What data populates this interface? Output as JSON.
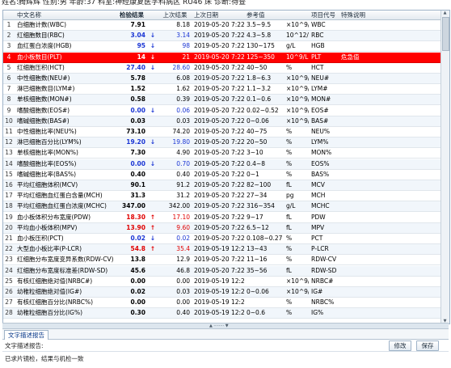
{
  "top_info": "姓名:腾辉辉  性别:男  年龄:37 科室:神经康复医学科病区 RU46 床 诊断:待查",
  "columns": [
    "中文名称",
    "检验结果",
    "上次结果",
    "上次日期",
    "参考值",
    "项目代号",
    "特殊说明"
  ],
  "rows": [
    {
      "idx": "1",
      "name": "白细胞计数(WBC)",
      "result": "7.91",
      "flag": "",
      "last": "8.18",
      "date": "2019-05-20 7:22",
      "ref": "3.5~9.5",
      "unit": "×10^9/L",
      "code": "WBC",
      "note": ""
    },
    {
      "idx": "2",
      "name": "红细胞数目(RBC)",
      "result": "3.04",
      "flag": "↓",
      "last": "3.14",
      "date": "2019-05-20 7:22",
      "ref": "4.3~5.8",
      "unit": "10^12/L",
      "code": "RBC",
      "note": ""
    },
    {
      "idx": "3",
      "name": "血红蛋白浓度(HGB)",
      "result": "95",
      "flag": "↓",
      "last": "98",
      "date": "2019-05-20 7:22",
      "ref": "130~175",
      "unit": "g/L",
      "code": "HGB",
      "note": ""
    },
    {
      "idx": "4",
      "name": "血小板数目(PLT)",
      "result": "14",
      "flag": "↓",
      "last": "21",
      "date": "2019-05-20 7:22",
      "ref": "125~350",
      "unit": "10^9/L",
      "code": "PLT",
      "note": "危急值"
    },
    {
      "idx": "5",
      "name": "红细胞压积(HCT)",
      "result": "27.40",
      "flag": "↓",
      "last": "28.60",
      "date": "2019-05-20 7:22",
      "ref": "40~50",
      "unit": "%",
      "code": "HCT",
      "note": ""
    },
    {
      "idx": "6",
      "name": "中性细胞数(NEU#)",
      "result": "5.78",
      "flag": "",
      "last": "6.08",
      "date": "2019-05-20 7:22",
      "ref": "1.8~6.3",
      "unit": "×10^9/L",
      "code": "NEU#",
      "note": ""
    },
    {
      "idx": "7",
      "name": "淋巴细胞数目(LYM#)",
      "result": "1.52",
      "flag": "",
      "last": "1.62",
      "date": "2019-05-20 7:22",
      "ref": "1.1~3.2",
      "unit": "×10^9/L",
      "code": "LYM#",
      "note": ""
    },
    {
      "idx": "8",
      "name": "单核细胞数(MON#)",
      "result": "0.58",
      "flag": "",
      "last": "0.39",
      "date": "2019-05-20 7:22",
      "ref": "0.1~0.6",
      "unit": "×10^9/L",
      "code": "MON#",
      "note": ""
    },
    {
      "idx": "9",
      "name": "嗜酸细胞数(EOS#)",
      "result": "0.00",
      "flag": "↓",
      "last": "0.06",
      "date": "2019-05-20 7:22",
      "ref": "0.02~0.52",
      "unit": "×10^9/L",
      "code": "EOS#",
      "note": ""
    },
    {
      "idx": "10",
      "name": "嗜碱细胞数(BAS#)",
      "result": "0.03",
      "flag": "",
      "last": "0.03",
      "date": "2019-05-20 7:22",
      "ref": "0~0.06",
      "unit": "×10^9/L",
      "code": "BAS#",
      "note": ""
    },
    {
      "idx": "11",
      "name": "中性细胞比率(NEU%)",
      "result": "73.10",
      "flag": "",
      "last": "74.20",
      "date": "2019-05-20 7:22",
      "ref": "40~75",
      "unit": "%",
      "code": "NEU%",
      "note": ""
    },
    {
      "idx": "12",
      "name": "淋巴细胞百分比(LYM%)",
      "result": "19.20",
      "flag": "↓",
      "last": "19.80",
      "date": "2019-05-20 7:22",
      "ref": "20~50",
      "unit": "%",
      "code": "LYM%",
      "note": ""
    },
    {
      "idx": "13",
      "name": "单核细胞比率(MON%)",
      "result": "7.30",
      "flag": "",
      "last": "4.90",
      "date": "2019-05-20 7:22",
      "ref": "3~10",
      "unit": "%",
      "code": "MON%",
      "note": ""
    },
    {
      "idx": "14",
      "name": "嗜酸细胞比率(EOS%)",
      "result": "0.00",
      "flag": "↓",
      "last": "0.70",
      "date": "2019-05-20 7:22",
      "ref": "0.4~8",
      "unit": "%",
      "code": "EOS%",
      "note": ""
    },
    {
      "idx": "15",
      "name": "嗜碱细胞比率(BAS%)",
      "result": "0.40",
      "flag": "",
      "last": "0.40",
      "date": "2019-05-20 7:22",
      "ref": "0~1",
      "unit": "%",
      "code": "BAS%",
      "note": ""
    },
    {
      "idx": "16",
      "name": "平均红细胞体积(MCV)",
      "result": "90.1",
      "flag": "",
      "last": "91.2",
      "date": "2019-05-20 7:22",
      "ref": "82~100",
      "unit": "fL",
      "code": "MCV",
      "note": ""
    },
    {
      "idx": "17",
      "name": "平均红细胞血红蛋白含量(MCH)",
      "result": "31.3",
      "flag": "",
      "last": "31.2",
      "date": "2019-05-20 7:22",
      "ref": "27~34",
      "unit": "pg",
      "code": "MCH",
      "note": ""
    },
    {
      "idx": "18",
      "name": "平均红细胞血红蛋白浓度(MCHC)",
      "result": "347.00",
      "flag": "",
      "last": "342.00",
      "date": "2019-05-20 7:22",
      "ref": "316~354",
      "unit": "g/L",
      "code": "MCHC",
      "note": ""
    },
    {
      "idx": "19",
      "name": "血小板体积分布宽度(PDW)",
      "result": "18.30",
      "flag": "↑",
      "last": "17.10",
      "date": "2019-05-20 7:22",
      "ref": "9~17",
      "unit": "fL",
      "code": "PDW",
      "note": ""
    },
    {
      "idx": "20",
      "name": "平均血小板体积(MPV)",
      "result": "13.90",
      "flag": "↑",
      "last": "9.60",
      "date": "2019-05-20 7:22",
      "ref": "6.5~12",
      "unit": "fL",
      "code": "MPV",
      "note": ""
    },
    {
      "idx": "21",
      "name": "血小板压积(PCT)",
      "result": "0.02",
      "flag": "↓",
      "last": "0.02",
      "date": "2019-05-20 7:22",
      "ref": "0.108~0.27",
      "unit": "%",
      "code": "PCT",
      "note": ""
    },
    {
      "idx": "22",
      "name": "大型血小板比率(P-LCR)",
      "result": "54.8",
      "flag": "↑",
      "last": "35.4",
      "date": "2019-05-19 12:25",
      "ref": "13~43",
      "unit": "%",
      "code": "P-LCR",
      "note": ""
    },
    {
      "idx": "23",
      "name": "红细胞分布宽度变异系数(RDW-CV)",
      "result": "13.8",
      "flag": "",
      "last": "12.9",
      "date": "2019-05-20 7:22",
      "ref": "11~16",
      "unit": "%",
      "code": "RDW-CV",
      "note": ""
    },
    {
      "idx": "24",
      "name": "红细胞分布宽度标准差(RDW-SD)",
      "result": "45.6",
      "flag": "",
      "last": "46.8",
      "date": "2019-05-20 7:22",
      "ref": "35~56",
      "unit": "fL",
      "code": "RDW-SD",
      "note": ""
    },
    {
      "idx": "25",
      "name": "有核红细胞绝对值(NRBC#)",
      "result": "0.00",
      "flag": "",
      "last": "0.00",
      "date": "2019-05-19 12:25",
      "ref": "",
      "unit": "×10^9/L",
      "code": "NRBC#",
      "note": ""
    },
    {
      "idx": "26",
      "name": "幼稚粒细胞绝对值(IG#)",
      "result": "0.02",
      "flag": "",
      "last": "0.03",
      "date": "2019-05-19 12:25",
      "ref": "0~0.06",
      "unit": "×10^9/L",
      "code": "IG#",
      "note": ""
    },
    {
      "idx": "27",
      "name": "有核红细胞百分比(NRBC%)",
      "result": "0.00",
      "flag": "",
      "last": "0.00",
      "date": "2019-05-19 12:25",
      "ref": "",
      "unit": "%",
      "code": "NRBC%",
      "note": ""
    },
    {
      "idx": "28",
      "name": "幼稚粒细胞百分比(IG%)",
      "result": "0.30",
      "flag": "",
      "last": "0.40",
      "date": "2019-05-19 12:25",
      "ref": "0~0.6",
      "unit": "%",
      "code": "IG%",
      "note": ""
    }
  ],
  "highlight_row_idx": "4",
  "colors": {
    "critical_row": "#ff0000",
    "flag_up": "#e00000",
    "flag_down": "#1a35d4"
  },
  "desc_panel": {
    "tab_label": "文字描述报告",
    "label": "文字描述报告:",
    "modify_button": "修改",
    "save_button": "保存",
    "content": "已求片镜检，结果与机检一致"
  }
}
